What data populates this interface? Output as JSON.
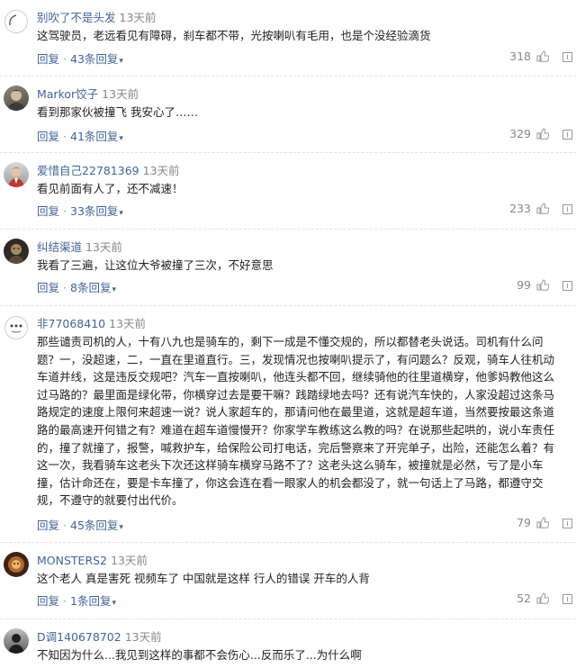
{
  "reply_label": "回复",
  "comments": [
    {
      "user": "别吹了不是头发",
      "time": "13天前",
      "text": "这驾驶员，老远看见有障碍，刹车都不带，光按喇叭有毛用，也是个没经验滴货",
      "replies": "43条回复",
      "likes": "318",
      "avatar": "anonymous-outline"
    },
    {
      "user": "Markor饺子",
      "time": "13天前",
      "text": "看到那家伙被撞飞 我安心了……",
      "replies": "41条回复",
      "likes": "329",
      "avatar": "photo-face"
    },
    {
      "user": "爱惜自己22781369",
      "time": "13天前",
      "text": "看见前面有人了，还不减速！",
      "replies": "33条回复",
      "likes": "233",
      "avatar": "photo-person"
    },
    {
      "user": "纠结渠道",
      "time": "13天前",
      "text": "我看了三遍，让这位大爷被撞了三次，不好意思",
      "replies": "8条回复",
      "likes": "99",
      "avatar": "photo-dark"
    },
    {
      "user": "非77068410",
      "time": "13天前",
      "text": "那些谴责司机的人，十有八九也是骑车的，剩下一成是不懂交规的，所以都替老头说话。司机有什么问题？一，没超速，二，一直在里道直行。三，发现情况也按喇叭提示了，有问题么？反观，骑车人往机动车道并线，这是违反交规吧？汽车一直按喇叭，他连头都不回，继续骑他的往里道横穿，他爹妈教他这么过马路的？最里面是绿化带，你横穿过去是要干嘛？践踏绿地去吗？还有说汽车快的，人家没超过这条马路规定的速度上限何来超速一说？说人家超车的，那请问他在最里道，这就是超车道，当然要按最这条道路的最高速开何错之有？难道在超车道慢慢开？你家学车教练这么教的吗？在说那些起哄的，说小车责任的，撞了就撞了，报警，喊救护车，给保险公司打电话，完后警察来了开完单子，出险，还能怎么着？有这一次，我看骑车这老头下次还这样骑车横穿马路不了？这老头这么骑车，被撞就是必然，亏了是小车撞，估计命还在，要是卡车撞了，你这会连在看一眼家人的机会都没了，就一句话上了马路，都遵守交规，不遵守的就要付出代价。",
      "replies": "45条回复",
      "likes": "79",
      "avatar": "anonymous-dots"
    },
    {
      "user": "MONSTERS2",
      "time": "13天前",
      "text": "这个老人 真是害死 视频车了 中国就是这样 行人的错误 开车的人背",
      "replies": "1条回复",
      "likes": "52",
      "avatar": "photo-warm"
    },
    {
      "user": "D调140678702",
      "time": "13天前",
      "text": "不知因为什么...我见到这样的事都不会伤心...反而乐了...为什么啊",
      "replies": "",
      "likes": "",
      "avatar": "photo-silhouette"
    }
  ]
}
